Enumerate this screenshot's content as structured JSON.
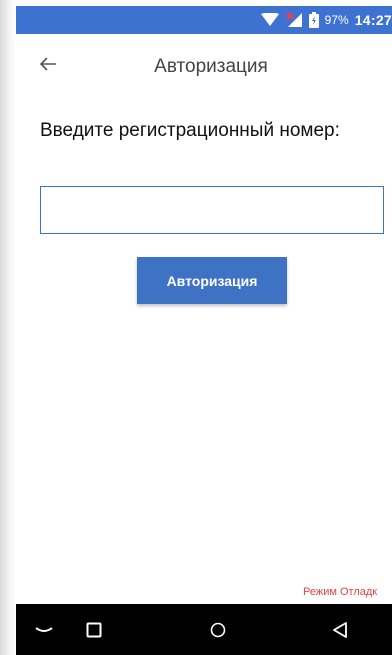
{
  "status_bar": {
    "battery_percent": "97%",
    "time": "14:27",
    "icons": [
      "wifi-icon",
      "signal-icon",
      "battery-icon"
    ],
    "background_color": "#3e72d1"
  },
  "app_bar": {
    "back_icon": "arrow-left-icon",
    "title": "Авторизация"
  },
  "form": {
    "prompt": "Введите регистрационный номер:",
    "input_value": "",
    "input_placeholder": "",
    "submit_label": "Авторизация",
    "accent_color": "#3e72c5"
  },
  "debug_mode_label": "Режим Отладк",
  "nav_bar": {
    "icons": [
      "keyboard-hide-icon",
      "recent-apps-icon",
      "home-icon",
      "back-icon"
    ]
  }
}
